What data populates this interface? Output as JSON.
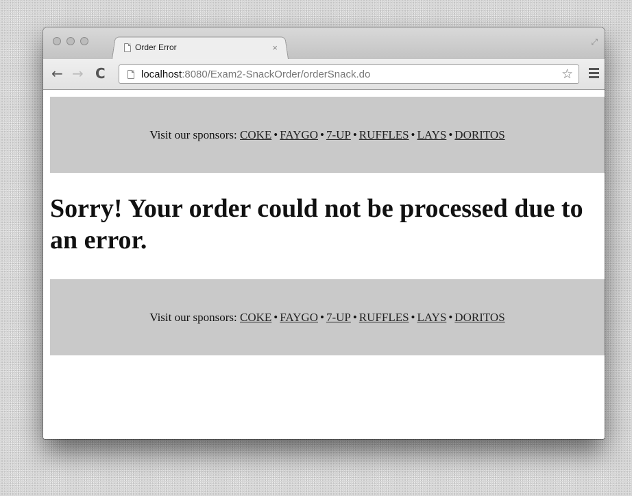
{
  "browser": {
    "tab_title": "Order Error",
    "tab_close": "×",
    "url_host": "localhost",
    "url_path": ":8080/Exam2-SnackOrder/orderSnack.do",
    "icons": {
      "back": "left-arrow-icon",
      "forward": "right-arrow-icon",
      "reload": "reload-icon",
      "page": "document-icon",
      "bookmark": "star-icon",
      "menu": "hamburger-menu-icon"
    }
  },
  "sponsors": {
    "label": "Visit our sponsors:",
    "separator": "•",
    "links": [
      "COKE",
      "FAYGO",
      "7-UP",
      "RUFFLES",
      "LAYS",
      "DORITOS"
    ]
  },
  "message": {
    "heading": "Sorry! Your order could not be processed due to an error."
  },
  "colors": {
    "sponsor_bar_bg": "#c9c9c9",
    "page_bg": "#ffffff"
  }
}
